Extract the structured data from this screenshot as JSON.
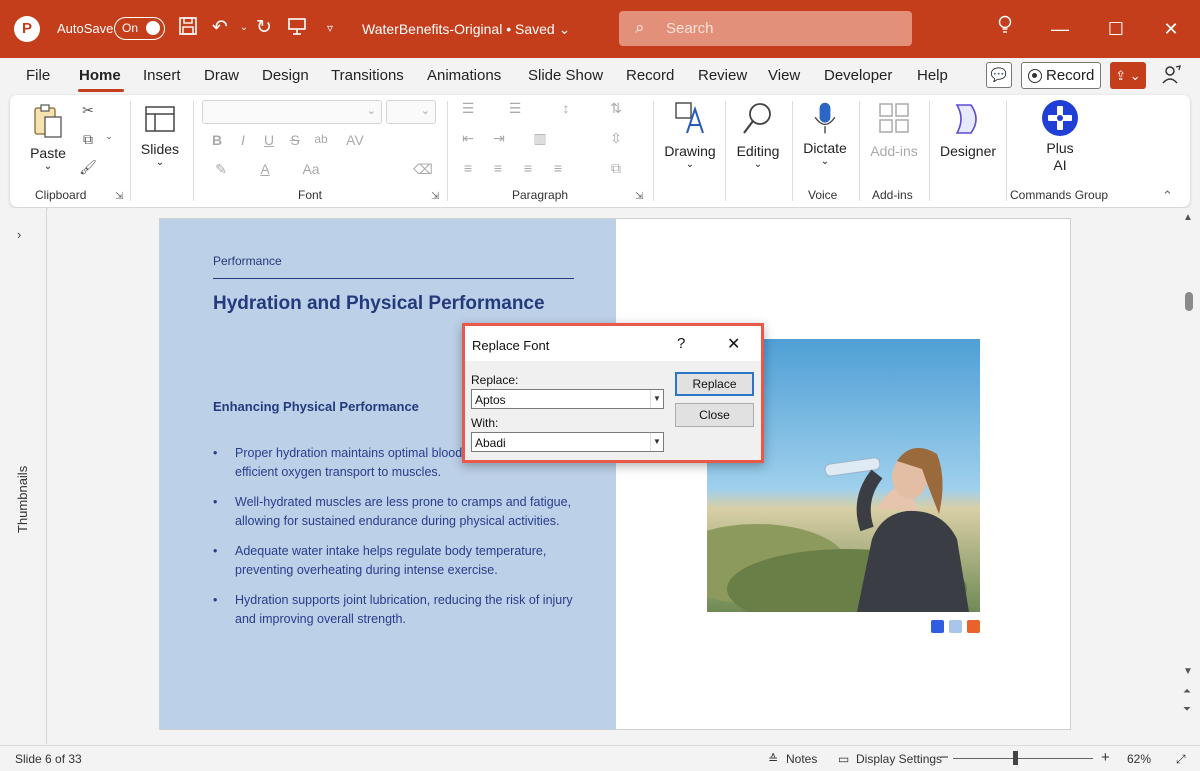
{
  "titlebar": {
    "app_logo": "P",
    "autosave_label": "AutoSave",
    "autosave_state": "On",
    "doc_title": "WaterBenefits-Original • Saved ⌄",
    "search_placeholder": "Search",
    "icons": [
      "save-icon",
      "undo-icon",
      "redo-icon",
      "present-icon",
      "customize-icon",
      "lightbulb-icon",
      "minimize-icon",
      "maximize-icon",
      "close-icon"
    ]
  },
  "menu": {
    "tabs": [
      "File",
      "Home",
      "Insert",
      "Draw",
      "Design",
      "Transitions",
      "Animations",
      "Slide Show",
      "Record",
      "Review",
      "View",
      "Developer",
      "Help"
    ],
    "active_tab": "Home",
    "record_label": "Record"
  },
  "ribbon": {
    "paste_label": "Paste",
    "slides_label": "Slides",
    "drawing_label": "Drawing",
    "editing_label": "Editing",
    "dictate_label": "Dictate",
    "addins_label": "Add-ins",
    "designer_label": "Designer",
    "plusai_label_1": "Plus",
    "plusai_label_2": "AI",
    "groups": {
      "clipboard": "Clipboard",
      "font": "Font",
      "paragraph": "Paragraph",
      "voice": "Voice",
      "addins": "Add-ins",
      "commands": "Commands Group"
    },
    "font_buttons": [
      "B",
      "I",
      "U",
      "S",
      "ab",
      "AV",
      "A",
      "Aa"
    ]
  },
  "thumbnails": {
    "label": "Thumbnails"
  },
  "slide": {
    "kicker": "Performance",
    "headline": "Hydration and Physical Performance",
    "subhead": "Enhancing Physical Performance",
    "bullets": [
      "Proper hydration maintains optimal blood volume, ensuring efficient oxygen transport to muscles.",
      "Well-hydrated muscles are less prone to cramps and fatigue, allowing for sustained endurance during physical activities.",
      "Adequate water intake helps regulate body temperature, preventing overheating during intense exercise.",
      "Hydration supports joint lubrication, reducing the risk of injury and improving overall strength."
    ],
    "swatch_colors": [
      "#2f5fe0",
      "#a9c6ea",
      "#e8622d"
    ]
  },
  "dialog": {
    "title": "Replace Font",
    "help": "?",
    "replace_label": "Replace:",
    "replace_value": "Aptos",
    "with_label": "With:",
    "with_value": "Abadi",
    "replace_button": "Replace",
    "close_button": "Close"
  },
  "statusbar": {
    "slide_info": "Slide 6 of 33",
    "notes_label": "Notes",
    "display_label": "Display Settings",
    "zoom_minus": "−",
    "zoom_plus": "+",
    "zoom_level": "62%"
  },
  "colors": {
    "accent": "#c43e1c",
    "slide_panel": "#bcd0e8",
    "slide_text": "#243a7c",
    "dialog_border": "#e8594a"
  }
}
